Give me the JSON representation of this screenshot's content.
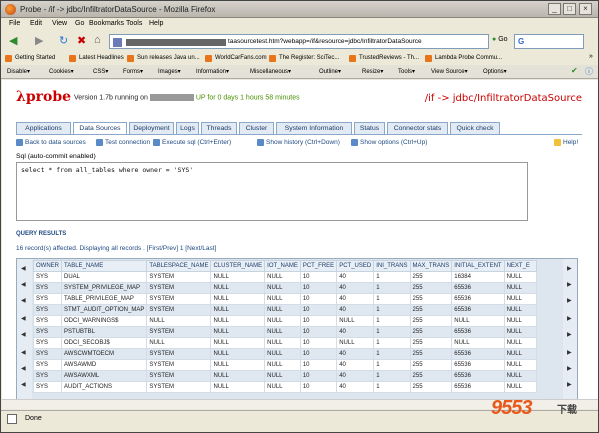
{
  "window": {
    "title": "Probe - /if -> jdbc/InfiltratorDataSource - Mozilla Firefox"
  },
  "menubar": [
    "File",
    "Edit",
    "View",
    "Go",
    "Bookmarks",
    "Tools",
    "Help"
  ],
  "nav": {
    "url": "taasourcetest.htm?webapp=/if&resource=jdbc/InfiltratorDataSource",
    "go_label": "Go",
    "search_text": "G"
  },
  "bookmarks": [
    "Getting Started",
    "Latest Headlines",
    "Sun releases Java un...",
    "WorldCarFans.com",
    "The Register: SciTec...",
    "TrustedReviews - Th...",
    "Lambda Probe Commu..."
  ],
  "devbar": [
    "Disable▾",
    "Cookies▾",
    "CSS▾",
    "Forms▾",
    "Images▾",
    "Information▾",
    "Miscellaneous▾",
    "Outline▾",
    "Resize▾",
    "Tools▾",
    "View Source▾",
    "Options▾"
  ],
  "header": {
    "logo": "λprobe",
    "version_prefix": "Version 1.7b running on",
    "version_up": "UP for 0 days 1 hours 58 minutes",
    "path": "/if -> jdbc/InfiltratorDataSource"
  },
  "tabs": [
    "Applications",
    "Data Sources",
    "Deployment",
    "Logs",
    "Threads",
    "Cluster",
    "System Information",
    "Status",
    "Connector stats",
    "Quick check"
  ],
  "actions": {
    "back": "Back to data sources",
    "test": "Test connection",
    "exec": "Execute sql (Ctrl+Enter)",
    "history": "Show history (Ctrl+Down)",
    "options": "Show options (Ctrl+Up)",
    "help": "Help!"
  },
  "sql": {
    "label": "Sql (auto-commit enabled)",
    "query": "select * from all_tables where owner = 'SYS'"
  },
  "results": {
    "title": "QUERY RESULTS",
    "summary": "16 record(s) affected. Displaying all records . [First/Prev] 1 [Next/Last]",
    "columns": [
      "OWNER",
      "TABLE_NAME",
      "TABLESPACE_NAME",
      "CLUSTER_NAME",
      "IOT_NAME",
      "PCT_FREE",
      "PCT_USED",
      "INI_TRANS",
      "MAX_TRANS",
      "INITIAL_EXTENT",
      "NEXT_E"
    ],
    "rows": [
      [
        "SYS",
        "DUAL",
        "SYSTEM",
        "NULL",
        "NULL",
        "10",
        "40",
        "1",
        "255",
        "16384",
        "NULL"
      ],
      [
        "SYS",
        "SYSTEM_PRIVILEGE_MAP",
        "SYSTEM",
        "NULL",
        "NULL",
        "10",
        "40",
        "1",
        "255",
        "65536",
        "NULL"
      ],
      [
        "SYS",
        "TABLE_PRIVILEGE_MAP",
        "SYSTEM",
        "NULL",
        "NULL",
        "10",
        "40",
        "1",
        "255",
        "65536",
        "NULL"
      ],
      [
        "SYS",
        "STMT_AUDIT_OPTION_MAP",
        "SYSTEM",
        "NULL",
        "NULL",
        "10",
        "40",
        "1",
        "255",
        "65536",
        "NULL"
      ],
      [
        "SYS",
        "ODCI_WARNINGS$",
        "NULL",
        "NULL",
        "NULL",
        "10",
        "NULL",
        "1",
        "255",
        "NULL",
        "NULL"
      ],
      [
        "SYS",
        "PSTUBTBL",
        "SYSTEM",
        "NULL",
        "NULL",
        "10",
        "40",
        "1",
        "255",
        "65536",
        "NULL"
      ],
      [
        "SYS",
        "ODCI_SECOBJ$",
        "NULL",
        "NULL",
        "NULL",
        "10",
        "NULL",
        "1",
        "255",
        "NULL",
        "NULL"
      ],
      [
        "SYS",
        "AWSCWMTOECM",
        "SYSTEM",
        "NULL",
        "NULL",
        "10",
        "40",
        "1",
        "255",
        "65536",
        "NULL"
      ],
      [
        "SYS",
        "AWSAWMD",
        "SYSTEM",
        "NULL",
        "NULL",
        "10",
        "40",
        "1",
        "255",
        "65536",
        "NULL"
      ],
      [
        "SYS",
        "AWSAWXML",
        "SYSTEM",
        "NULL",
        "NULL",
        "10",
        "40",
        "1",
        "255",
        "65536",
        "NULL"
      ],
      [
        "SYS",
        "AUDIT_ACTIONS",
        "SYSTEM",
        "NULL",
        "NULL",
        "10",
        "40",
        "1",
        "255",
        "65536",
        "NULL"
      ]
    ]
  },
  "status": "Done",
  "watermark": {
    "main": "9553",
    "sub": "下载"
  }
}
